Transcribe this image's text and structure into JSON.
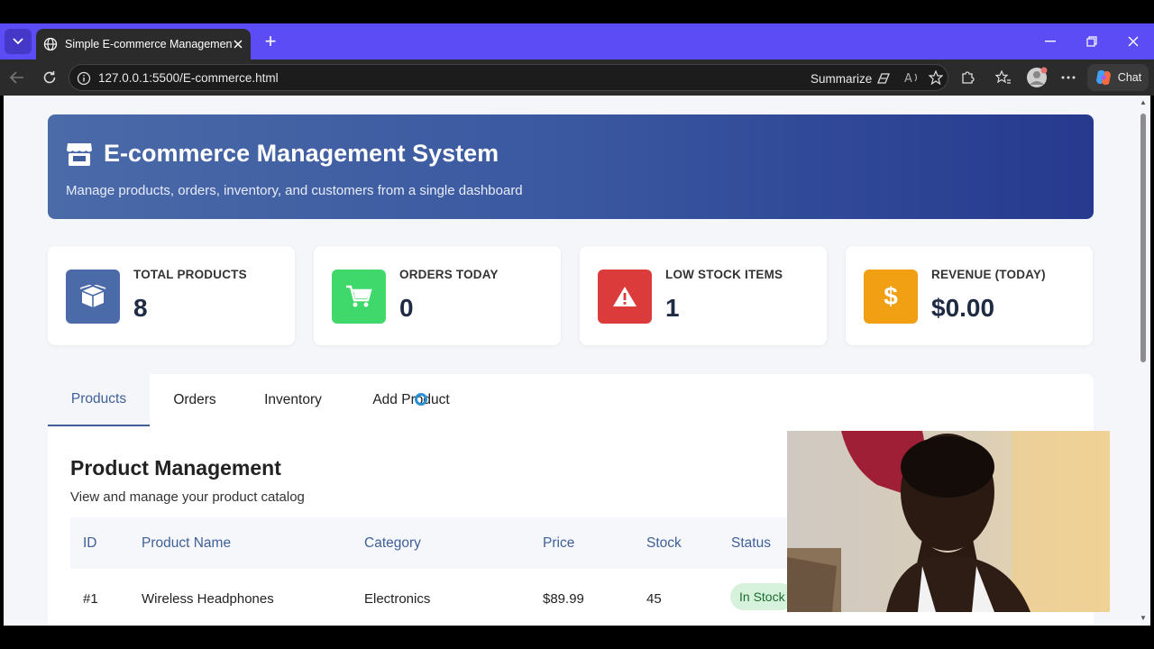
{
  "browser": {
    "tab_title": "Simple E-commerce Management",
    "url": "127.0.0.1:5500/E-commerce.html",
    "summarize_label": "Summarize",
    "chat_label": "Chat"
  },
  "header": {
    "title": "E-commerce Management System",
    "subtitle": "Manage products, orders, inventory, and customers from a single dashboard"
  },
  "stats": [
    {
      "label": "TOTAL PRODUCTS",
      "value": "8",
      "color": "#4a6aa8",
      "icon": "box-icon"
    },
    {
      "label": "ORDERS TODAY",
      "value": "0",
      "color": "#3fd86a",
      "icon": "cart-icon"
    },
    {
      "label": "LOW STOCK ITEMS",
      "value": "1",
      "color": "#dc3b3b",
      "icon": "warning-icon"
    },
    {
      "label": "REVENUE (TODAY)",
      "value": "$0.00",
      "color": "#f1a013",
      "icon": "dollar-icon"
    }
  ],
  "tabs": [
    "Products",
    "Orders",
    "Inventory",
    "Add Product"
  ],
  "content": {
    "title": "Product Management",
    "subtitle": "View and manage your product catalog",
    "columns": [
      "ID",
      "Product Name",
      "Category",
      "Price",
      "Stock",
      "Status"
    ],
    "rows": [
      [
        "#1",
        "Wireless Headphones",
        "Electronics",
        "$89.99",
        "45",
        "In Stock"
      ]
    ]
  }
}
